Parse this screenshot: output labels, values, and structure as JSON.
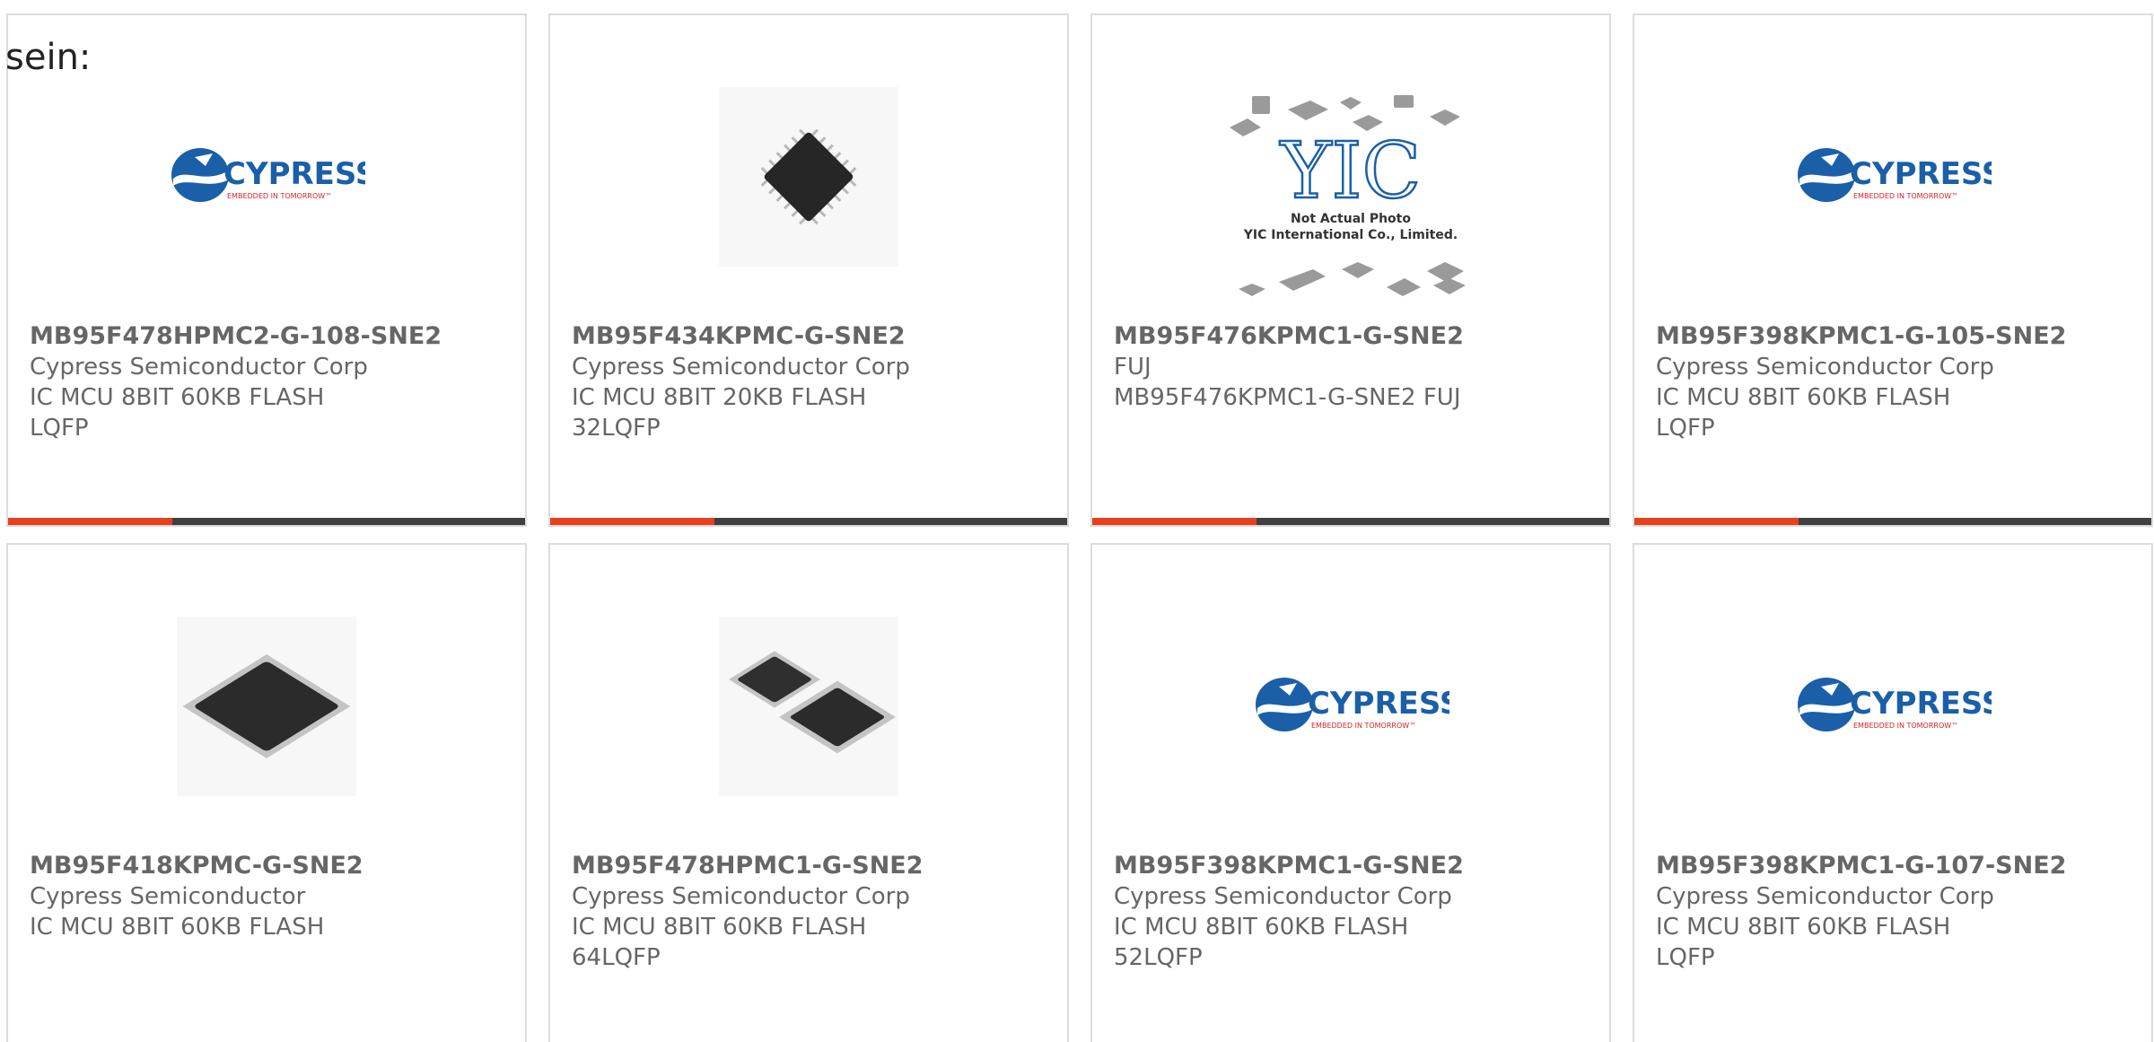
{
  "intro_text": "sein:",
  "colors": {
    "accent": "#e8401c",
    "bar": "#404040",
    "text": "#666666",
    "border": "#dcdcdc",
    "cypress_blue": "#1a5fa8",
    "cypress_red": "#d2232a"
  },
  "logos": {
    "cypress_name": "CYPRESS",
    "cypress_tagline": "EMBEDDED IN TOMORROW™",
    "yic_mark": "YIC",
    "yic_line1": "Not Actual Photo",
    "yic_line2": "YIC International Co., Limited."
  },
  "products": [
    {
      "part": "MB95F478HPMC2-G-108-SNE2",
      "manufacturer": "Cypress Semiconductor Corp",
      "description": "IC MCU 8BIT 60KB FLASH LQFP",
      "image": "cypress-logo"
    },
    {
      "part": "MB95F434KPMC-G-SNE2",
      "manufacturer": "Cypress Semiconductor Corp",
      "description": "IC MCU 8BIT 20KB FLASH 32LQFP",
      "image": "chip-small-photo"
    },
    {
      "part": "MB95F476KPMC1-G-SNE2",
      "manufacturer": "FUJ",
      "description": "MB95F476KPMC1-G-SNE2 FUJ",
      "image": "yic-placeholder"
    },
    {
      "part": "MB95F398KPMC1-G-105-SNE2",
      "manufacturer": "Cypress Semiconductor Corp",
      "description": "IC MCU 8BIT 60KB FLASH LQFP",
      "image": "cypress-logo"
    },
    {
      "part": "MB95F418KPMC-G-SNE2",
      "manufacturer": "Cypress Semiconductor",
      "description": "IC MCU 8BIT 60KB FLASH",
      "image": "chip-large-photo"
    },
    {
      "part": "MB95F478HPMC1-G-SNE2",
      "manufacturer": "Cypress Semiconductor Corp",
      "description": "IC MCU 8BIT 60KB FLASH 64LQFP",
      "image": "chip-pair-photo"
    },
    {
      "part": "MB95F398KPMC1-G-SNE2",
      "manufacturer": "Cypress Semiconductor Corp",
      "description": "IC MCU 8BIT 60KB FLASH 52LQFP",
      "image": "cypress-logo"
    },
    {
      "part": "MB95F398KPMC1-G-107-SNE2",
      "manufacturer": "Cypress Semiconductor Corp",
      "description": "IC MCU 8BIT 60KB FLASH LQFP",
      "image": "cypress-logo"
    }
  ]
}
